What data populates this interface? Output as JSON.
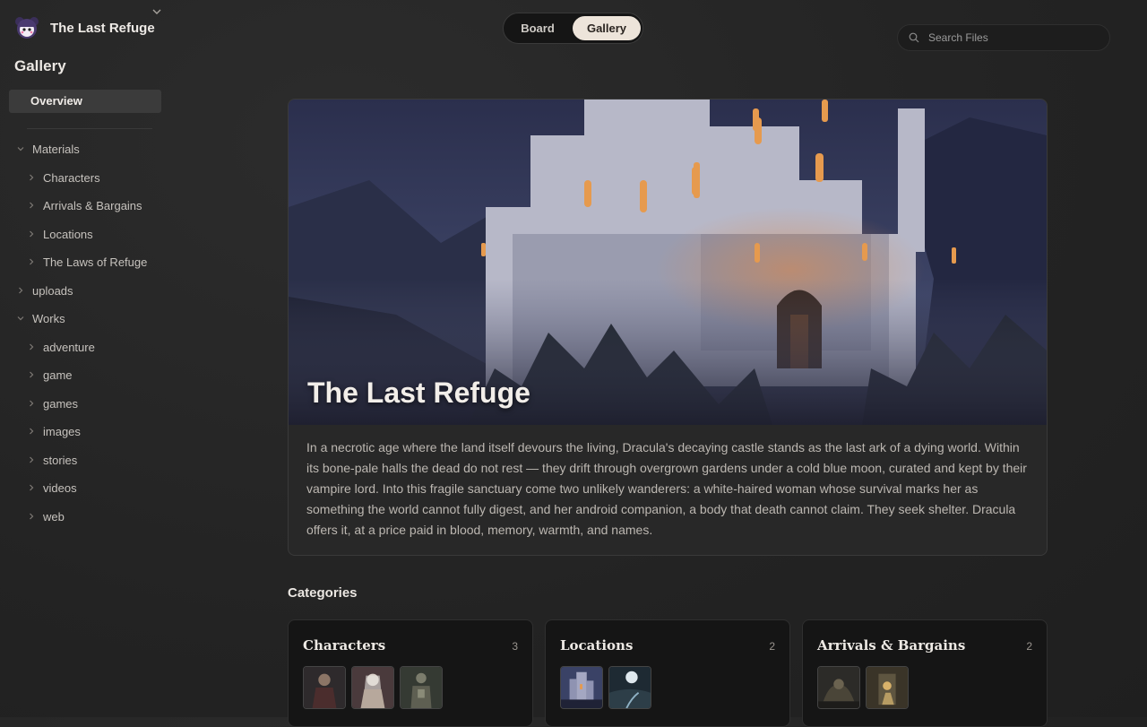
{
  "workspace": {
    "name": "The Last Refuge"
  },
  "sidebar": {
    "section_title": "Gallery",
    "overview_label": "Overview",
    "tree": [
      {
        "label": "Materials",
        "expanded": true,
        "level": 0
      },
      {
        "label": "Characters",
        "expanded": false,
        "level": 1
      },
      {
        "label": "Arrivals & Bargains",
        "expanded": false,
        "level": 1
      },
      {
        "label": "Locations",
        "expanded": false,
        "level": 1
      },
      {
        "label": "The Laws of Refuge",
        "expanded": false,
        "level": 1
      },
      {
        "label": "uploads",
        "expanded": false,
        "level": 0
      },
      {
        "label": "Works",
        "expanded": true,
        "level": 0
      },
      {
        "label": "adventure",
        "expanded": false,
        "level": 1
      },
      {
        "label": "game",
        "expanded": false,
        "level": 1
      },
      {
        "label": "games",
        "expanded": false,
        "level": 1
      },
      {
        "label": "images",
        "expanded": false,
        "level": 1
      },
      {
        "label": "stories",
        "expanded": false,
        "level": 1
      },
      {
        "label": "videos",
        "expanded": false,
        "level": 1
      },
      {
        "label": "web",
        "expanded": false,
        "level": 1
      }
    ]
  },
  "view_toggle": {
    "board_label": "Board",
    "gallery_label": "Gallery",
    "active": "Gallery"
  },
  "search": {
    "placeholder": "Search Files"
  },
  "hero": {
    "title": "The Last Refuge",
    "description": "In a necrotic age where the land itself devours the living, Dracula's decaying castle stands as the last ark of a dying world. Within its bone-pale halls the dead do not rest — they drift through overgrown gardens under a cold blue moon, curated and kept by their vampire lord. Into this fragile sanctuary come two unlikely wanderers: a white-haired woman whose survival marks her as something the world cannot fully digest, and her android companion, a body that death cannot claim. They seek shelter. Dracula offers it, at a price paid in blood, memory, warmth, and names."
  },
  "categories": {
    "heading": "Categories",
    "items": [
      {
        "title": "Characters",
        "count": "3"
      },
      {
        "title": "Locations",
        "count": "2"
      },
      {
        "title": "Arrivals & Bargains",
        "count": "2"
      }
    ]
  },
  "colors": {
    "accent_toggle": "#ede4da",
    "background": "#262626",
    "card": "#151515"
  }
}
